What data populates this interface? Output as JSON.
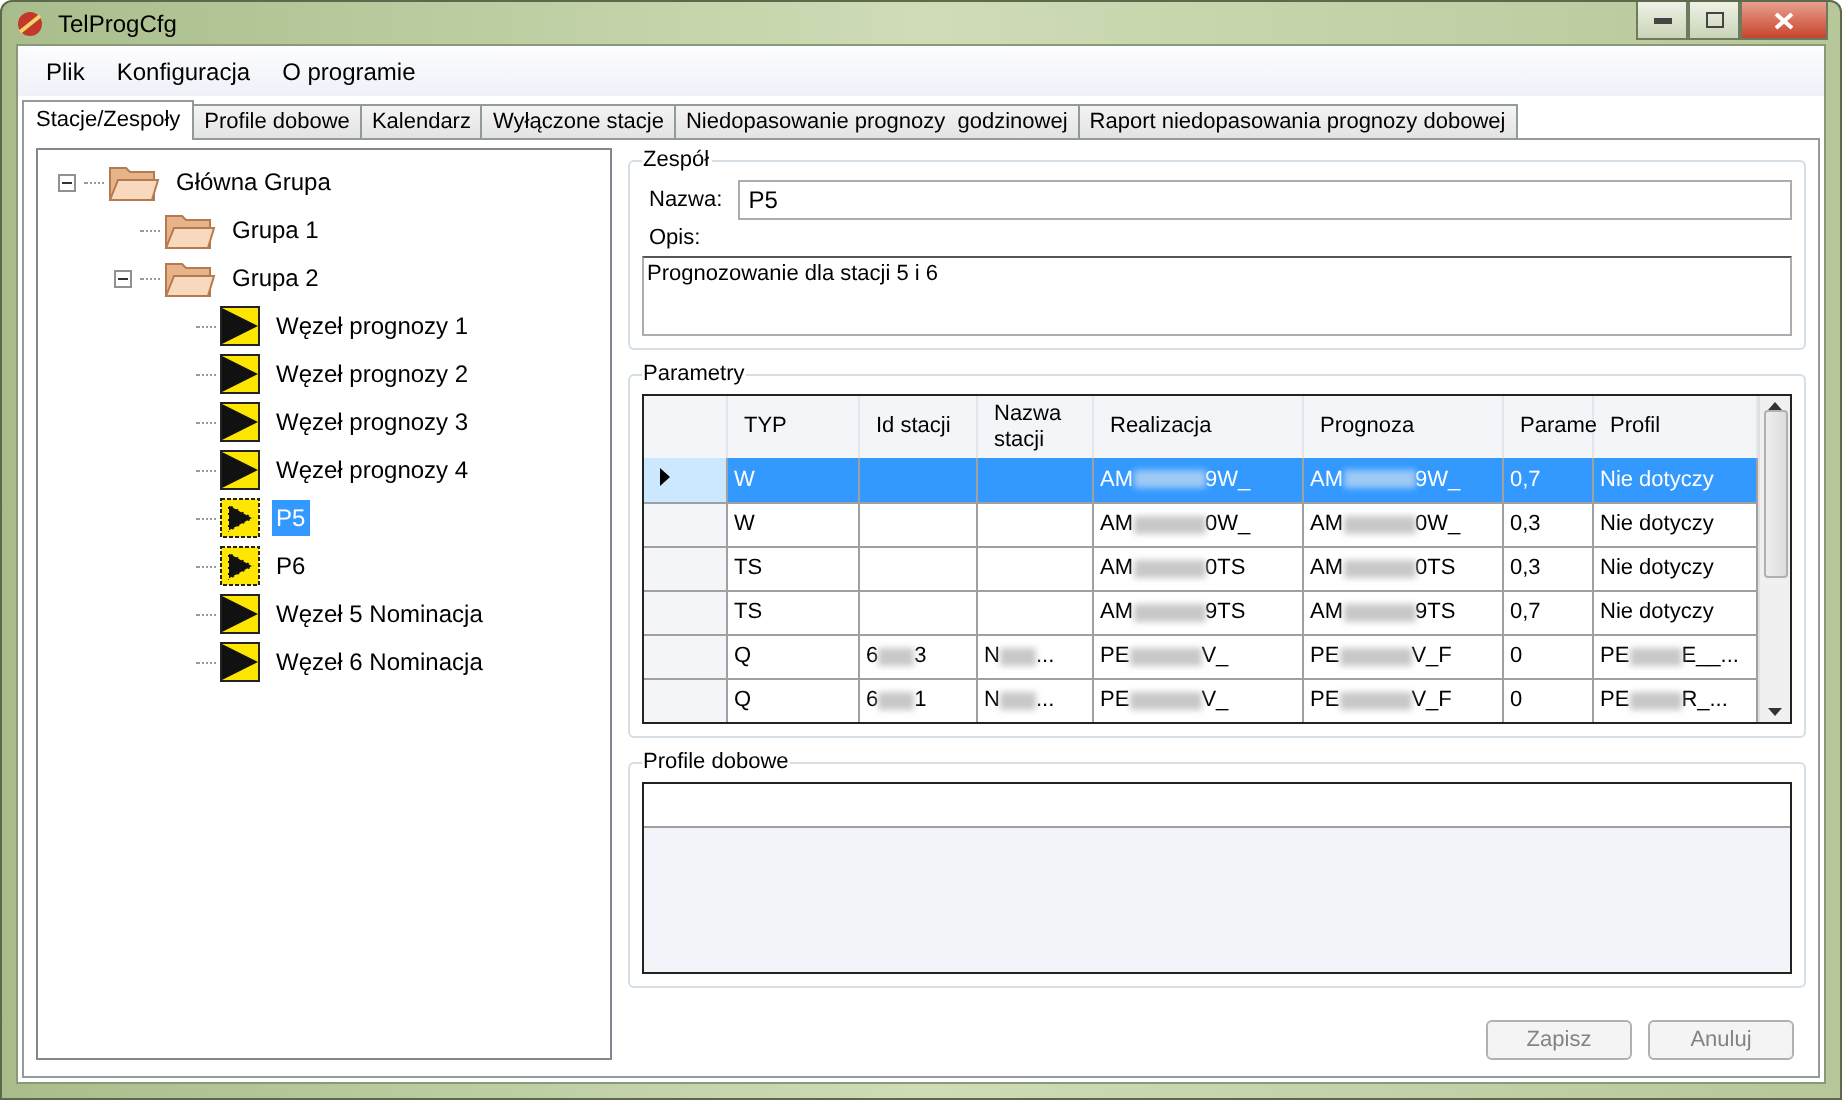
{
  "window": {
    "title": "TelProgCfg"
  },
  "menu": [
    "Plik",
    "Konfiguracja",
    "O programie"
  ],
  "tabs": [
    {
      "label": "Stacje/Zespoły",
      "selected": true
    },
    {
      "label": "Profile dobowe",
      "selected": false
    },
    {
      "label": "Kalendarz",
      "selected": false
    },
    {
      "label": "Wyłączone stacje",
      "selected": false
    },
    {
      "label": "Niedopasowanie prognozy  godzinowej",
      "selected": false
    },
    {
      "label": "Raport niedopasowania prognozy dobowej",
      "selected": false
    }
  ],
  "tree": [
    {
      "label": "Główna Grupa",
      "kind": "folder",
      "expanded": true,
      "selected": false,
      "children": [
        {
          "label": "Grupa 1",
          "kind": "folder",
          "selected": false
        },
        {
          "label": "Grupa 2",
          "kind": "folder",
          "expanded": true,
          "selected": false,
          "children": [
            {
              "label": "Węzeł prognozy 1",
              "kind": "node",
              "selected": false
            },
            {
              "label": "Węzeł prognozy 2",
              "kind": "node",
              "selected": false
            },
            {
              "label": "Węzeł prognozy 3",
              "kind": "node",
              "selected": false
            },
            {
              "label": "Węzeł prognozy 4",
              "kind": "node",
              "selected": false
            },
            {
              "label": "P5",
              "kind": "team",
              "selected": true
            },
            {
              "label": "P6",
              "kind": "team",
              "selected": false
            },
            {
              "label": "Węzeł 5 Nominacja",
              "kind": "node",
              "selected": false
            },
            {
              "label": "Węzeł 6 Nominacja",
              "kind": "node",
              "selected": false
            }
          ]
        }
      ]
    }
  ],
  "team": {
    "title": "Zespół",
    "name_label": "Nazwa:",
    "name_value": "P5",
    "desc_label": "Opis:",
    "desc_value": "Prognozowanie dla stacji 5 i 6"
  },
  "parameters": {
    "title": "Parametry",
    "columns": [
      "TYP",
      "Id stacji",
      "Nazwa stacji",
      "Realizacja",
      "Prognoza",
      "Parame",
      "Profil"
    ],
    "rows": [
      {
        "selected": true,
        "cells": [
          {
            "text": "W"
          },
          {
            "text": ""
          },
          {
            "text": ""
          },
          {
            "start": "AM",
            "end": "9W_"
          },
          {
            "start": "AM",
            "end": "9W_"
          },
          {
            "text": "0,7"
          },
          {
            "text": "Nie dotyczy"
          }
        ]
      },
      {
        "selected": false,
        "cells": [
          {
            "text": "W"
          },
          {
            "text": ""
          },
          {
            "text": ""
          },
          {
            "start": "AM",
            "end": "0W_"
          },
          {
            "start": "AM",
            "end": "0W_"
          },
          {
            "text": "0,3"
          },
          {
            "text": "Nie dotyczy"
          }
        ]
      },
      {
        "selected": false,
        "cells": [
          {
            "text": "TS"
          },
          {
            "text": ""
          },
          {
            "text": ""
          },
          {
            "start": "AM",
            "end": "0TS"
          },
          {
            "start": "AM",
            "end": "0TS"
          },
          {
            "text": "0,3"
          },
          {
            "text": "Nie dotyczy"
          }
        ]
      },
      {
        "selected": false,
        "cells": [
          {
            "text": "TS"
          },
          {
            "text": ""
          },
          {
            "text": ""
          },
          {
            "start": "AM",
            "end": "9TS"
          },
          {
            "start": "AM",
            "end": "9TS"
          },
          {
            "text": "0,7"
          },
          {
            "text": "Nie dotyczy"
          }
        ]
      },
      {
        "selected": false,
        "cells": [
          {
            "text": "Q"
          },
          {
            "start": "6",
            "end": "3"
          },
          {
            "start": "N",
            "end": "..."
          },
          {
            "start": "PE",
            "end": "V_"
          },
          {
            "start": "PE",
            "end": "V_F"
          },
          {
            "text": "0"
          },
          {
            "start": "PE",
            "end": "E__..."
          }
        ]
      },
      {
        "selected": false,
        "cells": [
          {
            "text": "Q"
          },
          {
            "start": "6",
            "end": "1"
          },
          {
            "start": "N",
            "end": "..."
          },
          {
            "start": "PE",
            "end": "V_"
          },
          {
            "start": "PE",
            "end": "V_F"
          },
          {
            "text": "0"
          },
          {
            "start": "PE",
            "end": "R_..."
          }
        ]
      }
    ]
  },
  "profiles": {
    "title": "Profile dobowe"
  },
  "buttons": [
    {
      "label": "Zapisz",
      "disabled": true
    },
    {
      "label": "Anuluj",
      "disabled": true
    }
  ]
}
